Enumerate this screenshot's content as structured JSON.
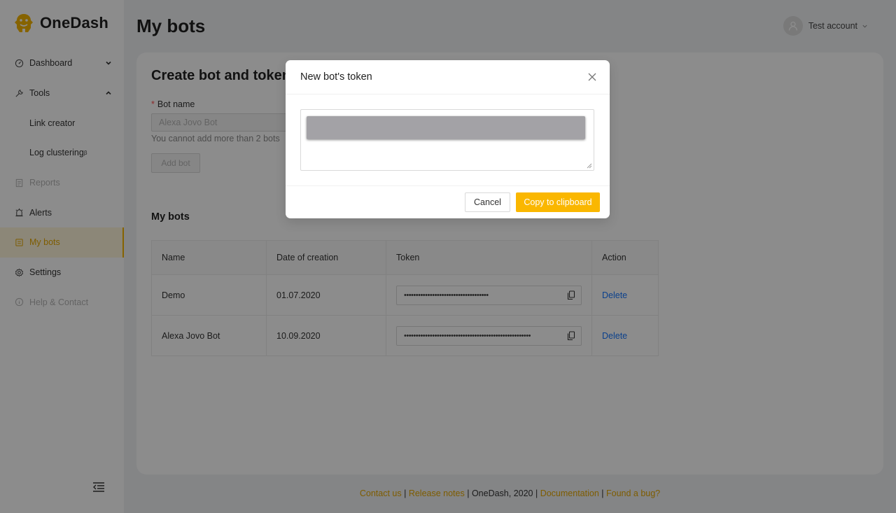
{
  "app": {
    "name": "OneDash",
    "logo_icon": "gorilla-logo-icon"
  },
  "colors": {
    "accent": "#fab700",
    "link": "#1677ff",
    "danger": "#ff4d4f"
  },
  "sidebar": {
    "items": [
      {
        "label": "Dashboard",
        "icon": "dashboard-icon"
      },
      {
        "label": "Tools",
        "icon": "wrench-icon"
      },
      {
        "label": "Link creator"
      },
      {
        "label": "Log clustering",
        "superscript": "β"
      },
      {
        "label": "Reports",
        "icon": "report-icon"
      },
      {
        "label": "Alerts",
        "icon": "alarm-icon"
      },
      {
        "label": "My bots",
        "icon": "robot-icon"
      },
      {
        "label": "Settings",
        "icon": "gear-icon"
      },
      {
        "label": "Help & Contact",
        "icon": "info-icon"
      }
    ]
  },
  "header": {
    "title": "My bots",
    "account": "Test account"
  },
  "create": {
    "title": "Create bot and token",
    "field_label": "Bot name",
    "field_value": "Alexa Jovo Bot",
    "hint": "You cannot add more than 2 bots",
    "add_label": "Add bot"
  },
  "bots": {
    "title": "My bots",
    "columns": [
      "Name",
      "Date of creation",
      "Token",
      "Action"
    ],
    "rows": [
      {
        "name": "Demo",
        "date": "01.07.2020",
        "token": "••••••••••••••••••••••••••••••••••••",
        "action": "Delete"
      },
      {
        "name": "Alexa Jovo Bot",
        "date": "10.09.2020",
        "token": "••••••••••••••••••••••••••••••••••••••••••••••••••••••",
        "action": "Delete"
      }
    ]
  },
  "footer": {
    "contact": "Contact us",
    "release": "Release notes",
    "copyright": "OneDash, 2020",
    "docs": "Documentation",
    "bug": "Found a bug?",
    "sep": " | "
  },
  "modal": {
    "title": "New bot's token",
    "cancel": "Cancel",
    "copy": "Copy to clipboard"
  }
}
